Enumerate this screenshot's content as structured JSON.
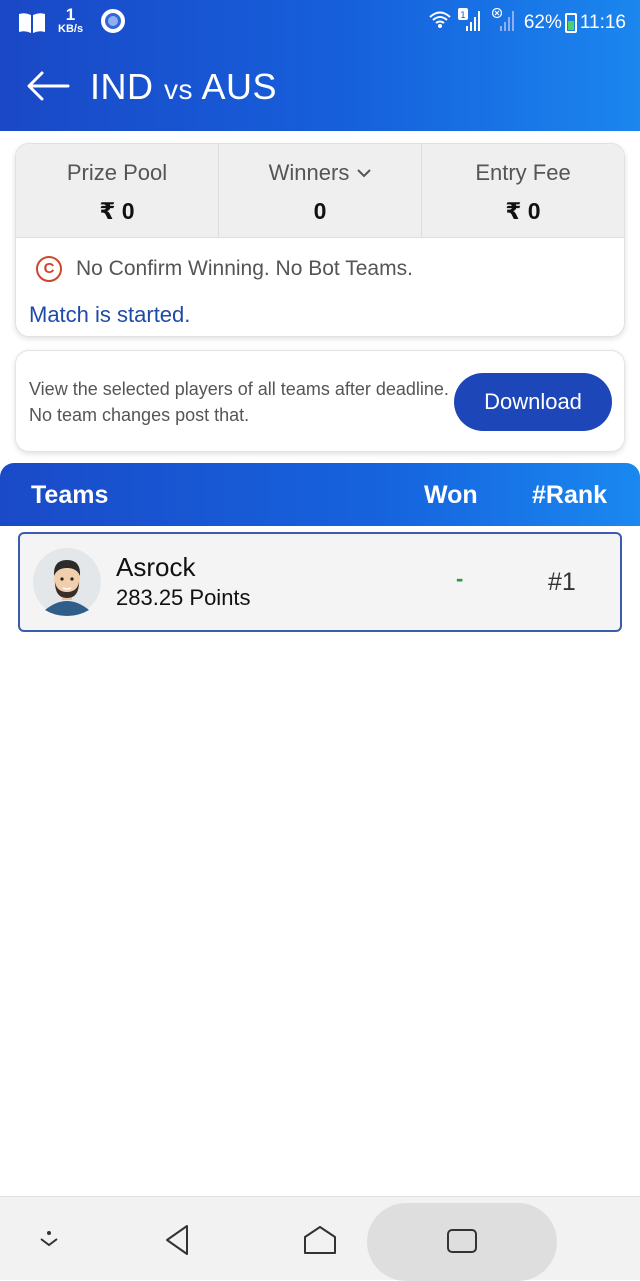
{
  "status_bar": {
    "speed_value": "1",
    "speed_unit": "KB/s",
    "battery": "62%",
    "time": "11:16",
    "icons": [
      "book-icon",
      "circle-dot-icon",
      "wifi-icon",
      "sim1-signal-icon",
      "sim2-signal-icon",
      "battery-icon"
    ]
  },
  "app_bar": {
    "back_icon": "arrow-left-icon",
    "title_team1": "IND",
    "title_vs": "vs",
    "title_team2": "AUS"
  },
  "contest": {
    "prize_pool_label": "Prize Pool",
    "prize_pool_value": "₹ 0",
    "winners_label": "Winners",
    "winners_value": "0",
    "entry_fee_label": "Entry Fee",
    "entry_fee_value": "₹ 0",
    "confirm_icon_letter": "C",
    "notice": "No Confirm Winning. No Bot Teams.",
    "match_status": "Match is started."
  },
  "download_card": {
    "line1": "View the selected players of all teams after deadline.",
    "line2": "No team changes post that.",
    "button_label": "Download"
  },
  "teams_table": {
    "headers": {
      "teams": "Teams",
      "won": "Won",
      "rank": "#Rank"
    },
    "rows": [
      {
        "name": "Asrock",
        "points": "283.25 Points",
        "won": "-",
        "rank": "#1"
      }
    ]
  },
  "colors": {
    "header_start": "#1a48c6",
    "header_end": "#1b86ee",
    "button": "#1d47b8",
    "link": "#1e4aa8",
    "won": "#2e9a3a"
  }
}
